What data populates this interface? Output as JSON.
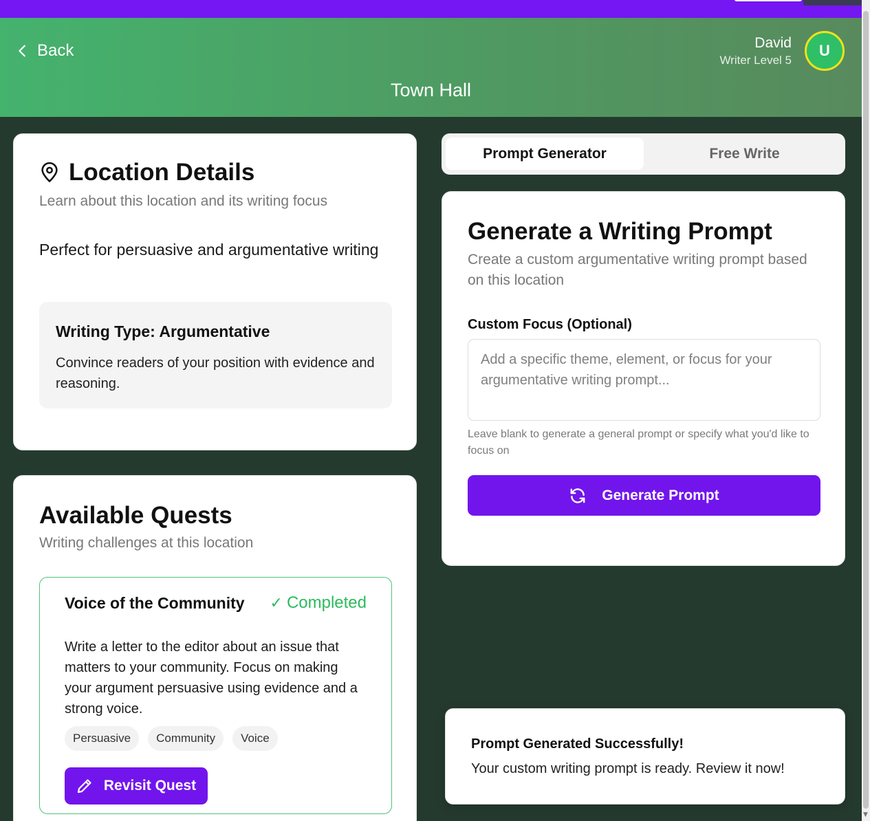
{
  "header": {
    "back_label": "Back",
    "page_title": "Town Hall",
    "user_name": "David",
    "user_level": "Writer Level 5",
    "avatar_initial": "U"
  },
  "location": {
    "title": "Location Details",
    "subtitle": "Learn about this location and its writing focus",
    "description": "Perfect for persuasive and argumentative writing",
    "writing_type_title": "Writing Type: Argumentative",
    "writing_type_description": "Convince readers of your position with evidence and reasoning."
  },
  "quests": {
    "title": "Available Quests",
    "subtitle": "Writing challenges at this location",
    "items": [
      {
        "name": "Voice of the Community",
        "status_icon": "✓",
        "status": "Completed",
        "description": "Write a letter to the editor about an issue that matters to your community. Focus on making your argument persuasive using evidence and a strong voice.",
        "tags": [
          "Persuasive",
          "Community",
          "Voice"
        ],
        "button_label": "Revisit Quest"
      }
    ]
  },
  "tabs": [
    {
      "label": "Prompt Generator",
      "active": true
    },
    {
      "label": "Free Write",
      "active": false
    }
  ],
  "prompt": {
    "title": "Generate a Writing Prompt",
    "subtitle": "Create a custom argumentative writing prompt based on this location",
    "field_label": "Custom Focus (Optional)",
    "field_value": "",
    "field_placeholder": "Add a specific theme, element, or focus for your argumentative writing prompt...",
    "hint": "Leave blank to generate a general prompt or specify what you'd like to focus on",
    "button_label": "Generate Prompt"
  },
  "toast": {
    "title": "Prompt Generated Successfully!",
    "message": "Your custom writing prompt is ready. Review it now!"
  },
  "colors": {
    "topbar": "#7417f2",
    "header_start": "#44b36e",
    "header_end": "#588a5d",
    "background": "#253a2f",
    "primary_button": "#7215ec",
    "completed": "#2dbb5d",
    "avatar_ring": "#f2e21a"
  },
  "icons": [
    "chevron-left-icon",
    "map-pin-icon",
    "check-icon",
    "pencil-icon",
    "refresh-icon"
  ]
}
